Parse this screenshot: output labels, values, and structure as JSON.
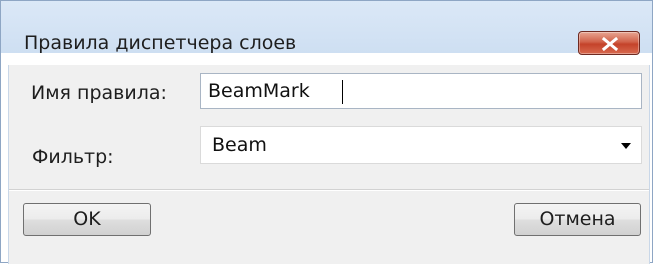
{
  "window": {
    "title": "Правила диспетчера слоев",
    "close_icon": "close-icon"
  },
  "form": {
    "rule_name_label": "Имя правила:",
    "rule_name_value": "BeamMark",
    "filter_label": "Фильтр:",
    "filter_value": "Beam",
    "filter_arrow_icon": "chevron-down-icon"
  },
  "buttons": {
    "ok_label": "OK",
    "cancel_label": "Отмена"
  },
  "colors": {
    "close_button": "#c4432a",
    "title_bar": "#dbe8f7",
    "client_background": "#f0f0f0"
  }
}
